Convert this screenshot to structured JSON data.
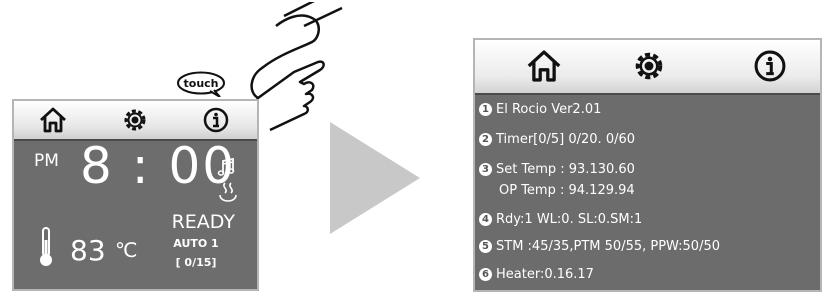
{
  "left_screen": {
    "icons": [
      "home-icon",
      "gear-icon",
      "info-icon"
    ],
    "period": "PM",
    "time": "8 : 00",
    "temperature": "83",
    "temp_unit": "℃",
    "status": "READY",
    "mode": "AUTO 1",
    "counter": "[ 0/15]"
  },
  "touch_label": "touch",
  "right_screen": {
    "icons": [
      "home-icon",
      "gear-icon",
      "info-icon"
    ],
    "lines": [
      {
        "num": "1",
        "text": "El Rocio Ver2.01"
      },
      {
        "num": "2",
        "text": "Timer[0/5] 0/20. 0/60"
      },
      {
        "num": "3",
        "text": "Set Temp : 93.130.60"
      },
      {
        "num": "",
        "text": "OP Temp : 94.129.94"
      },
      {
        "num": "4",
        "text": "Rdy:1 WL:0. SL:0.SM:1"
      },
      {
        "num": "5",
        "text": "STM :45/35,PTM 50/55, PPW:50/50"
      },
      {
        "num": "6",
        "text": "Heater:0.16.17"
      }
    ]
  },
  "colors": {
    "screen": "#6d6d6d",
    "arrow": "#c8c8c8",
    "topbar": "#f0f0f0"
  }
}
